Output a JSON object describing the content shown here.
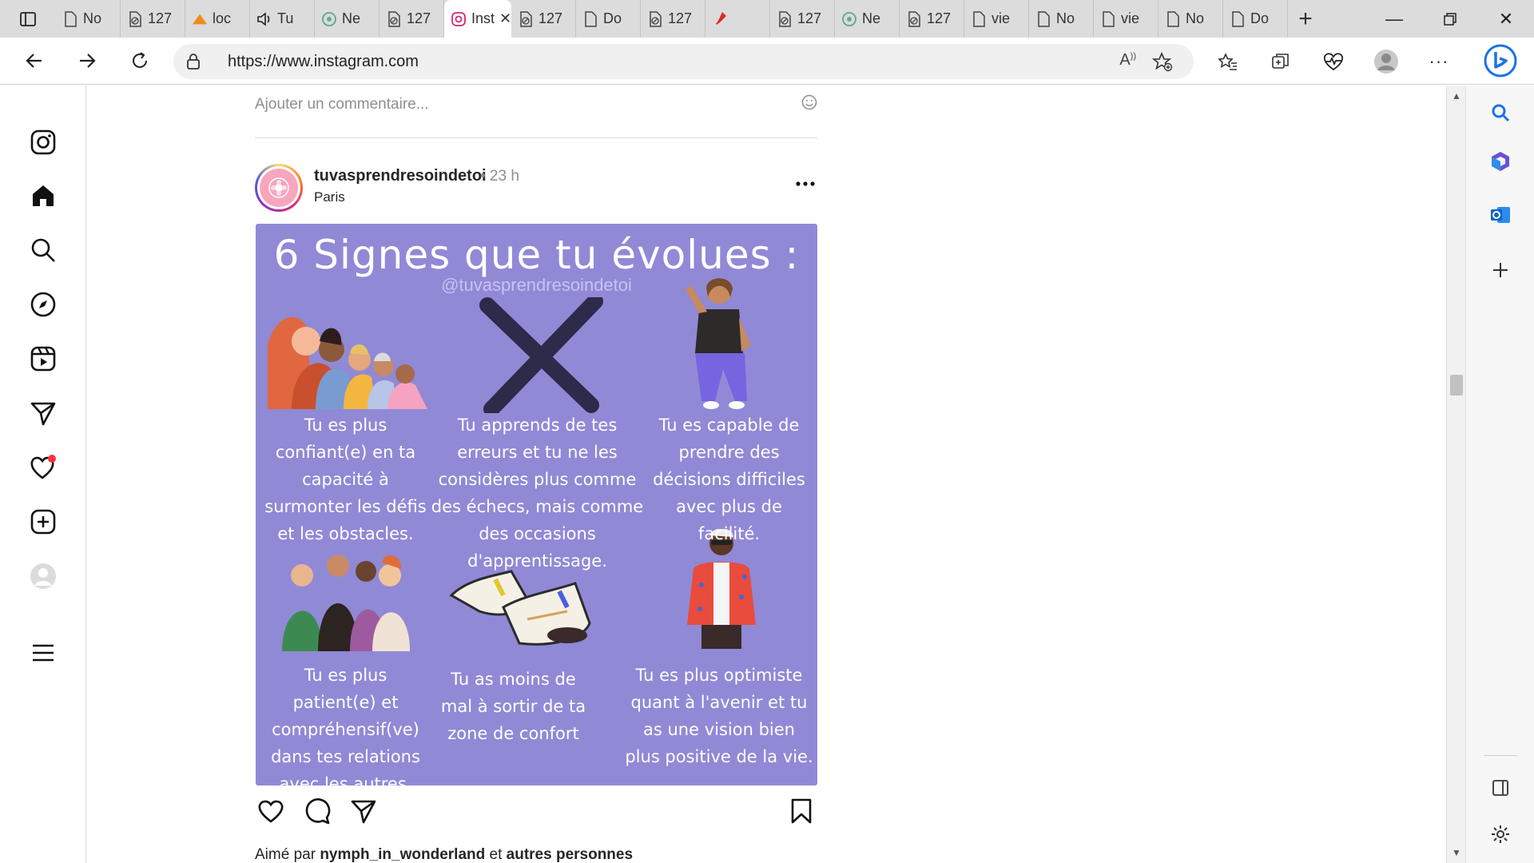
{
  "browser": {
    "tabs": [
      {
        "label": "No",
        "icon": "page-icon"
      },
      {
        "label": "127",
        "icon": "blocked-page-icon"
      },
      {
        "label": "loc",
        "icon": "pma-icon"
      },
      {
        "label": "Tu",
        "icon": "speaker-icon"
      },
      {
        "label": "Ne",
        "icon": "chatgpt-icon"
      },
      {
        "label": "127",
        "icon": "blocked-page-icon"
      },
      {
        "label": "Inst",
        "icon": "instagram-icon",
        "active": true
      },
      {
        "label": "127",
        "icon": "blocked-page-icon"
      },
      {
        "label": "Do",
        "icon": "page-icon"
      },
      {
        "label": "127",
        "icon": "blocked-page-icon"
      },
      {
        "label": "",
        "icon": "pin-icon"
      },
      {
        "label": "127",
        "icon": "blocked-page-icon"
      },
      {
        "label": "Ne",
        "icon": "chatgpt-icon"
      },
      {
        "label": "127",
        "icon": "blocked-page-icon"
      },
      {
        "label": "vie",
        "icon": "page-icon"
      },
      {
        "label": "No",
        "icon": "page-icon"
      },
      {
        "label": "vie",
        "icon": "page-icon"
      },
      {
        "label": "No",
        "icon": "page-icon"
      },
      {
        "label": "Do",
        "icon": "page-icon"
      }
    ],
    "url": "https://www.instagram.com"
  },
  "feed": {
    "comment_placeholder": "Ajouter un commentaire...",
    "post": {
      "username": "tuvasprendresoindetoi",
      "time": "• 23 h",
      "location": "Paris",
      "image": {
        "title": "6 Signes que tu évolues :",
        "handle": "@tuvasprendresoindetoi",
        "captions": [
          "Tu es plus confiant(e) en ta capacité à surmonter les défis et les obstacles.",
          "Tu apprends de tes erreurs et tu ne les considères plus comme des échecs, mais comme des occasions d'apprentissage.",
          "Tu es capable de prendre des décisions difficiles avec plus de facilité.",
          "Tu es plus patient(e) et compréhensif(ve) dans tes relations avec les autres.",
          "Tu as moins de mal à sortir de ta zone de confort",
          "Tu es plus optimiste quant à l'avenir et tu as une vision bien plus positive de la vie."
        ]
      },
      "likes": {
        "prefix": "Aimé par",
        "user": "nymph_in_wonderland",
        "middle": "et",
        "suffix": "autres personnes"
      }
    }
  },
  "colors": {
    "post_bg": "#9089d6",
    "notification_dot": "#ff3040",
    "accent": "#0a66c2"
  }
}
